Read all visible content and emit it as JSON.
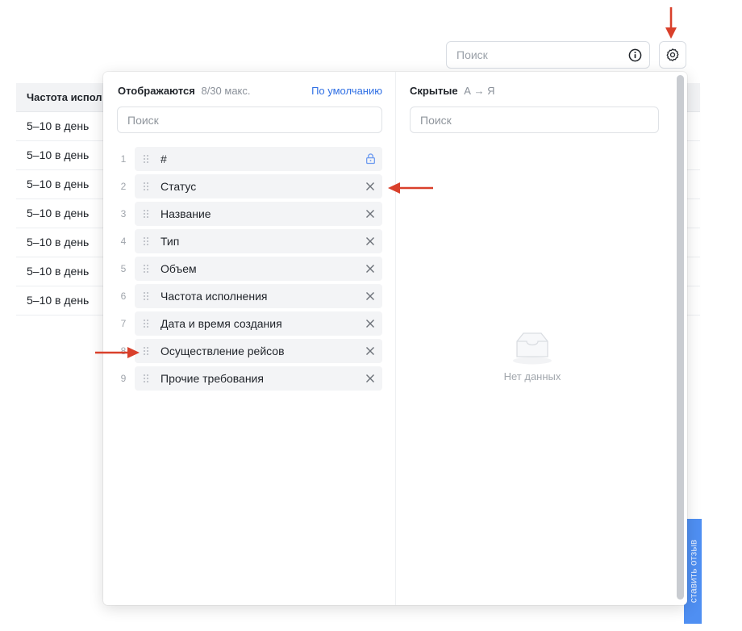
{
  "toolbar": {
    "search_placeholder": "Поиск",
    "info_icon": "info-circle-icon",
    "settings_icon": "gear-icon"
  },
  "table": {
    "header": "Частота испол",
    "rows": [
      "5–10 в день",
      "5–10 в день",
      "5–10 в день",
      "5–10 в день",
      "5–10 в день",
      "5–10 в день",
      "5–10 в день"
    ]
  },
  "feedback_tab": {
    "label": "ставить отзыв"
  },
  "column_settings": {
    "visible": {
      "title": "Отображаются",
      "count": "8/30 макс.",
      "reset_label": "По умолчанию",
      "search_placeholder": "Поиск",
      "items": [
        {
          "index": "1",
          "label": "#",
          "locked": true
        },
        {
          "index": "2",
          "label": "Статус",
          "locked": false
        },
        {
          "index": "3",
          "label": "Название",
          "locked": false
        },
        {
          "index": "4",
          "label": "Тип",
          "locked": false
        },
        {
          "index": "5",
          "label": "Объем",
          "locked": false
        },
        {
          "index": "6",
          "label": "Частота исполнения",
          "locked": false
        },
        {
          "index": "7",
          "label": "Дата и время создания",
          "locked": false
        },
        {
          "index": "8",
          "label": "Осуществление рейсов",
          "locked": false
        },
        {
          "index": "9",
          "label": "Прочие требования",
          "locked": false
        }
      ]
    },
    "hidden": {
      "title": "Скрытые",
      "sort": "А → Я",
      "search_placeholder": "Поиск",
      "empty_text": "Нет данных"
    }
  },
  "colors": {
    "accent": "#2f6fe4",
    "annotation_arrow": "#d9402b",
    "feedback_tab": "#4f8ff2"
  }
}
